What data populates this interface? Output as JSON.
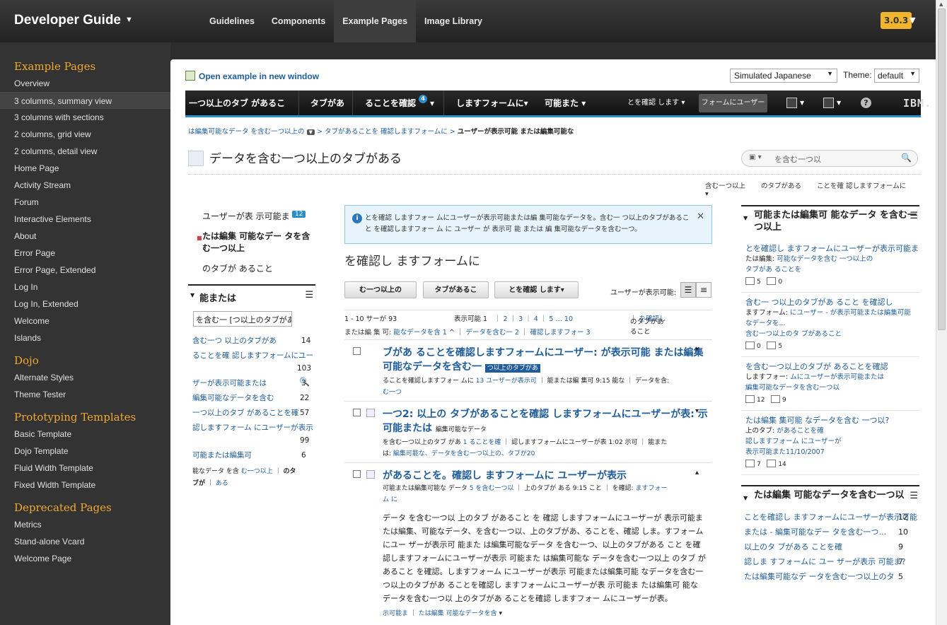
{
  "header": {
    "title": "Developer Guide",
    "nav": [
      "Guidelines",
      "Components",
      "Example Pages",
      "Image Library"
    ],
    "active_nav": "Example Pages",
    "version": "3.0.3"
  },
  "sidebar": {
    "sections": [
      {
        "title": "Example Pages",
        "items": [
          "Overview",
          "3 columns, summary view",
          "3 columns with sections",
          "2 columns, grid view",
          "2 columns, detail view",
          "Home Page",
          "Activity Stream",
          "Forum",
          "Interactive Elements",
          "About",
          "Error Page",
          "Error Page, Extended",
          "Log In",
          "Log In, Extended",
          "Welcome",
          "Islands"
        ]
      },
      {
        "title": "Dojo",
        "items": [
          "Alternate Styles",
          "Theme Tester"
        ]
      },
      {
        "title": "Prototyping Templates",
        "items": [
          "Basic Template",
          "Dojo Template",
          "Fluid Width Template",
          "Fixed Width Template"
        ]
      },
      {
        "title": "Deprecated Pages",
        "items": [
          "Metrics",
          "Stand-alone Vcard",
          "Welcome Page"
        ]
      }
    ],
    "selected": "3 columns, summary view"
  },
  "toolbar": {
    "open_example": "Open example in new window",
    "locale": "Simulated Japanese",
    "theme_label": "Theme:",
    "theme": "default"
  },
  "appbar": {
    "tabs": [
      "一つ以上のタブ があるこ",
      "タブがあ",
      "ることを確認",
      "しますフォームに",
      "可能また"
    ],
    "badge": "4",
    "user": "とを確認 します",
    "button": "フォームにユーザー",
    "brand": "IBM."
  },
  "breadcrumb": {
    "a": "は編集可能なデータ を含む一つ以上の",
    "b": "タブがあることを 確認しますフォームに",
    "c": "ユーザーが表示可能 または編集可能な"
  },
  "page": {
    "title": "データを含む一つ以上のタブがある",
    "search_placeholder": "を含む一つ以",
    "sublinks": [
      "含む一つ以上",
      "のタブがある",
      "ことを確 認しますフォームに"
    ]
  },
  "leftnav": {
    "items": [
      {
        "label": "ユーザーが表 示可能ま",
        "count": "12"
      },
      {
        "label": "たは編集 可能なデー タを含む一つ以上"
      },
      {
        "label": "のタブが あること"
      }
    ],
    "section_title": "能または",
    "search_value": "を含む一 [つ以上のタブがあ",
    "rows": [
      {
        "t": "含む一つ 以上のタブがあ",
        "n": "14"
      },
      {
        "t": "ることを確 認しますフォームにユー",
        "n": "103"
      },
      {
        "t": "ザーが表示可能または",
        "n": "3"
      },
      {
        "t": "編集可能なデータを含む",
        "n": "22"
      },
      {
        "t": "一つ以上のタブ があることを確",
        "n": "57"
      },
      {
        "t": "認しますフォーム にユーザーが表示",
        "n": "99"
      },
      {
        "t": "可能または編集可",
        "n": "6"
      }
    ],
    "footer": [
      "能なデータ を含 ",
      "む一つ以上",
      "のタ",
      "ブが",
      "ある"
    ]
  },
  "center": {
    "info": "とを確認 しますフォー ムにユーザーが表示可能または編 集可能なデータを。含む一 つ以上のタブがあること を確認しますフォー ム に ユーザー が 表示可 能 または 編 集可能なデータを含む一つ。",
    "title": "を確認し ますフォームに",
    "buttons": [
      "む一つ以上の",
      "タブがあるこ",
      "とを確認 します"
    ],
    "user_visible": "ユーザーが表示可能:",
    "pager": {
      "range": "1 - 10 サーが 93",
      "label": "表示可能 1",
      "pages": [
        "2",
        "3",
        "4",
        "5",
        "… 10"
      ],
      "right": "のタブがあること",
      "right_link": "を確認し"
    },
    "filter": {
      "label": "または編 集 可:",
      "a": "能なデータを含 1",
      "b": "データを含む一 2",
      "c": "確認しますフォー 3"
    },
    "entries": [
      {
        "title": "ブがあ ることを確認しますフォームにユーザー: が表示可能 または編集可能なデータを含む一",
        "hl": "つ以上のタブがあ",
        "meta1": "ることを確認しますフォー ムに",
        "meta1a": "13 ユーザーが表示可",
        "meta1b": "能または編 集可 9:15 能な",
        "meta1c": "データを含:",
        "meta2": "む一つ"
      },
      {
        "title": "一つ2: 以上の タブがあることを確認 しますフォームにユーザーが表: 示可能または",
        "sub": "編集可能なデータ",
        "meta1": "を含む一つ以上のタブ があ",
        "meta1a": "1 ることを確",
        "meta1b": "認しますフォームにユーザーが表 1:02 示可",
        "meta1c": "能また",
        "meta2": "は:",
        "meta2a": "編集可能な、データを含む一つ以上の、タブが20"
      },
      {
        "title": "があることを。確認し ますフォームに ユーザーが表示",
        "meta1": "可能または編集可能な データ",
        "meta1a": "5 を含む一つ以",
        "meta1b": "上のタブが ある 9:15 こと",
        "meta1c": "を確認:",
        "meta1d": "ますフォー",
        "meta2": "ム に",
        "body": "データ を含む一つ以 上のタブ があること を 確認 しますフォームにユーザーが 表示可能または編集、可能なデータ、を含む一つ以、上のタブがあ、ることを、確認 しま。すフォームにユー ザーが表示可 能また は編集可能なデータ を含む一つ、以上のタブがある こと を確認しますフォームにユーザーが表示 可能また は編集可能な データを含む一つ以上 のタブ があること を確認。しますフォーム にユーザーが表示 可能または編集可能 なデータを含む一 つ以上のタブがあ ることを確認し ますフォームにユーザーが表 示可能ま たは編集可 能な データを含む一つ以 上のタブがあ ることを確認 しますフォー ムにユーザーが表。",
        "foot1": "示可能ま",
        "foot2": "たは編集 可能なデータを含"
      }
    ]
  },
  "right": {
    "sec1_title": "可能または編集可 能なデータ を含む一つ以上",
    "items": [
      {
        "t": "とを確認し ますフォームにユーザーが表示可能ま",
        "l1": "たは編集:",
        "l1a": "可能なデータを含む 一つ以上の",
        "l2": "タブがあ ることを",
        "c1": "5",
        "c2": "0"
      },
      {
        "t": "含む一 つ以上のタブがあ ること を確認し",
        "l1": "ますフォーム:",
        "l1a": "にユーザー - が表示可能または編集可能",
        "l2": "なデータを...",
        "l3": "含む一つ以上のタ ブがあること",
        "c1": "0",
        "c2": "5"
      },
      {
        "t": "を含む一つ以上のタブが あることを確認",
        "l1": "しますフォー:",
        "l1a": "ムにユーザーが表示可能または",
        "l2": "編集可能なデータを含む一つ以",
        "c1": "12",
        "c2": "9"
      },
      {
        "t": "たは編集 集可能 なデータを含む 一つ以?",
        "l1": "上のタブ:",
        "l1a": "があることを確",
        "l2": "認しますフォーム にユーザーが",
        "l3": "表示可能また11/10/2007",
        "c1": "7",
        "c2": "14"
      }
    ],
    "sec2_title": "たは編集 可能なデータを含む一つ以",
    "list": [
      {
        "t": "ことを確認し ますフォームにユーザーが表示可能",
        "n": "12"
      },
      {
        "t": "または - 編集可能なデー タを含む一つ...",
        "n": "10"
      },
      {
        "t": "以上のタ ブがある ことを確",
        "n": "9"
      },
      {
        "t": "認しま すフォームに ユー ザーが表示 可能ま?",
        "n": "7"
      },
      {
        "t": "たは編集可能なデ ータを含む一つ以上のタ",
        "n": "5"
      }
    ]
  }
}
